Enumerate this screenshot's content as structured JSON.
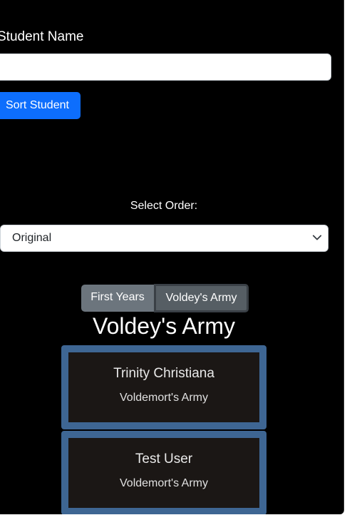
{
  "form": {
    "name_label": "Student Name",
    "name_value": "",
    "name_placeholder": "",
    "sort_button_label": "Sort Student"
  },
  "order": {
    "label": "Select Order:",
    "selected": "Original"
  },
  "tabs": [
    {
      "label": "First Years",
      "active": false
    },
    {
      "label": "Voldey's Army",
      "active": true
    }
  ],
  "list": {
    "title": "Voldey's Army",
    "students": [
      {
        "name": "Trinity Christiana",
        "house": "Voldemort's Army"
      },
      {
        "name": "Test User",
        "house": "Voldemort's Army"
      }
    ]
  },
  "colors": {
    "primary_button": "#0d6efd",
    "card_border": "#3e6693",
    "card_background": "#1b1715",
    "tab_inactive": "#6c757d",
    "tab_active": "#565e64"
  },
  "icons": {
    "select_arrow": "chevron-down-icon"
  }
}
